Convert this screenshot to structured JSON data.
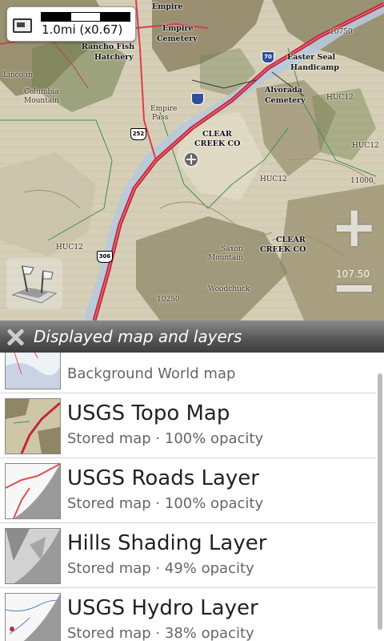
{
  "map": {
    "scale": {
      "label": "1.0mi (x0.67)"
    },
    "labels": {
      "empire_top": "Empire",
      "empire": "Empire",
      "empire_cemetery": "Cemetery",
      "rancho_fish": "Rancho Fish",
      "hatchery": "Hatchery",
      "easter_seal": "Easter Seal",
      "handicamp": "Handicamp",
      "alvorada": "Alvorada",
      "alvorada_cemetery": "Cemetery",
      "lincoln": "Linco in",
      "columbia": "Columbia",
      "mountain_left": "Mountain",
      "empire_pass": "Empire",
      "pass": "Pass",
      "clear_creek_co_1": "CLEAR",
      "clear_creek_co_2": "CREEK CO",
      "clear_creek_co_3": "CLEAR",
      "clear_creek_co_4": "CREEK CO",
      "saxon": "Saxon",
      "saxon_mountain": "Mountain",
      "woodchuck": "Woodchuck",
      "huc_labels": [
        "HUC12",
        "HUC12",
        "HUC12",
        "HUC12"
      ],
      "route_i70": "70",
      "route_252": "252",
      "route_306": "306",
      "elev_11000": "11000",
      "elev_10750": "10750",
      "elev_10250": "10250"
    },
    "zoom_in_icon": "plus-icon",
    "zoom_out_icon": "minus-icon",
    "zoom_value": "107.50",
    "layers_icon": "layers-flags-icon"
  },
  "panel": {
    "title": "Displayed map and layers",
    "close_icon": "close-x-icon"
  },
  "layers": [
    {
      "name": "",
      "sub": "Background World map",
      "thumb": "world-map-thumb"
    },
    {
      "name": "USGS Topo Map",
      "sub": "Stored map · 100% opacity",
      "thumb": "topo-thumb"
    },
    {
      "name": "USGS Roads Layer",
      "sub": "Stored map · 100% opacity",
      "thumb": "roads-thumb"
    },
    {
      "name": "Hills Shading Layer",
      "sub": "Stored map · 49% opacity",
      "thumb": "hills-thumb"
    },
    {
      "name": "USGS Hydro Layer",
      "sub": "Stored map · 38% opacity",
      "thumb": "hydro-thumb"
    }
  ],
  "colors": {
    "terrain_light": "#d9d2bc",
    "terrain_dark": "#8f8465",
    "forest": "#7a8a57",
    "road": "#c0283c",
    "panel_header": "#555555"
  }
}
